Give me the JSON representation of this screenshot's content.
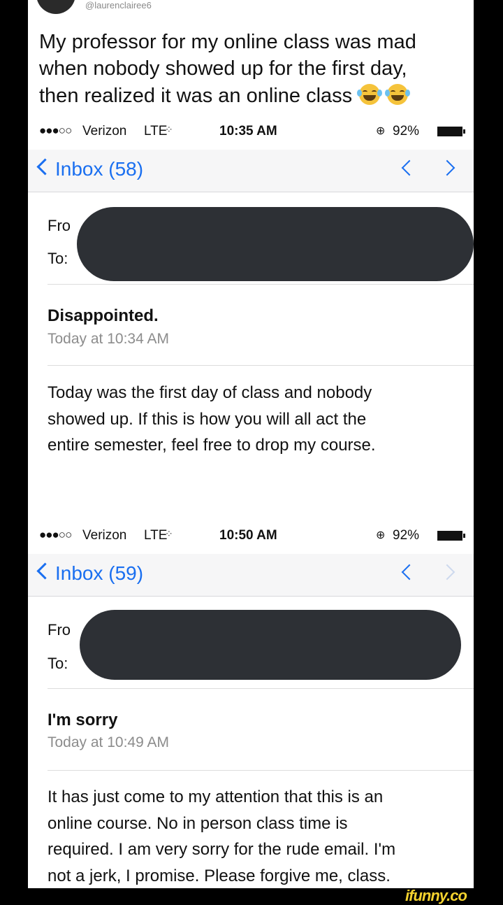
{
  "tweet": {
    "handle": "@laurenclairee6",
    "lines": [
      "My professor for my online class was mad",
      "when nobody showed up for the first day,",
      "then realized it was an online class"
    ]
  },
  "screens": [
    {
      "status": {
        "dots": "●●●○○",
        "carrier": "Verizon",
        "network": "LTE",
        "time": "10:35 AM",
        "battery": "92%"
      },
      "nav": {
        "back": "Inbox (58)"
      },
      "from_label": "Fro",
      "to_label": "To:",
      "subject": "Disappointed.",
      "date": "Today at 10:34 AM",
      "body": [
        "Today was the first day of class and nobody",
        "showed up. If this is how you will all act the",
        "entire semester, feel free to drop my course."
      ]
    },
    {
      "status": {
        "dots": "●●●○○",
        "carrier": "Verizon",
        "network": "LTE",
        "time": "10:50 AM",
        "battery": "92%"
      },
      "nav": {
        "back": "Inbox (59)"
      },
      "from_label": "Fro",
      "to_label": "To:",
      "subject": "I'm sorry",
      "date": "Today at 10:49 AM",
      "body": [
        "It has just come to my attention that this is an",
        "online course. No in person class time is",
        "required. I am very sorry for the rude email. I'm",
        "not a jerk, I promise. Please forgive me, class."
      ]
    }
  ],
  "watermark": "ifunny.co",
  "colors": {
    "link": "#1a6ff0",
    "redaction": "#2d3035",
    "watermark": "#f4d22e"
  }
}
